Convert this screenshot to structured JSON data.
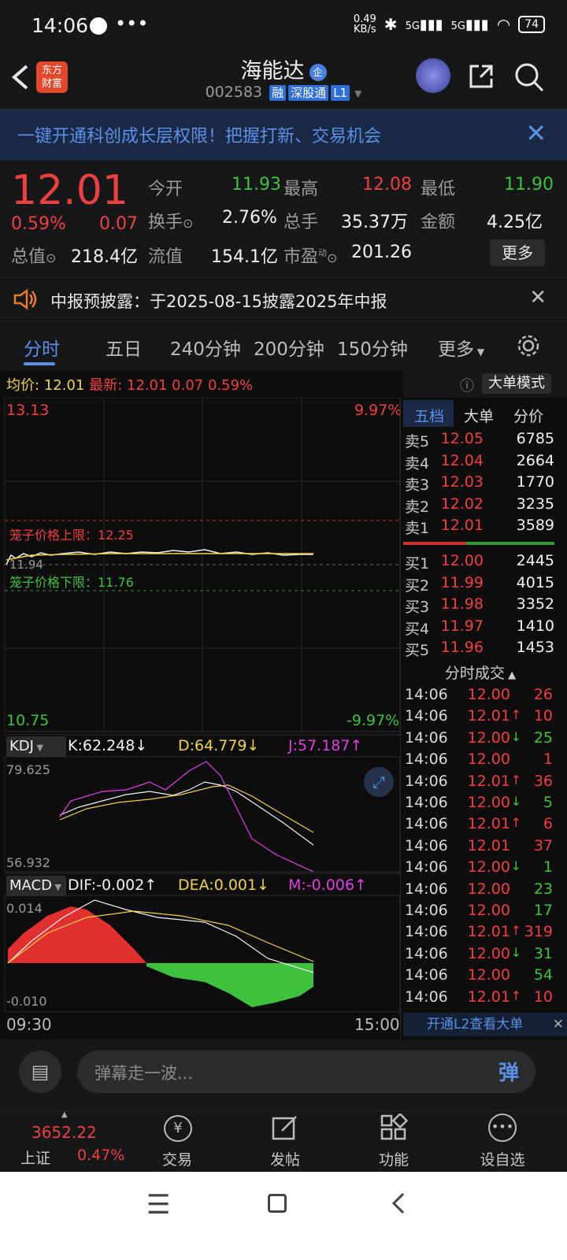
{
  "status": {
    "time": "14:06",
    "net_speed_top": "0.49",
    "net_speed_unit": "KB/s",
    "signal1": "5G",
    "signal2": "5G",
    "battery": "74"
  },
  "header": {
    "logo_line1": "东方",
    "logo_line2": "财富",
    "title": "海能达",
    "code": "002583",
    "badges": [
      "融",
      "深股通",
      "L1"
    ]
  },
  "banner": {
    "text": "一键开通科创成长层权限！把握打新、交易机会"
  },
  "quote": {
    "price": "12.01",
    "change_pct": "0.59%",
    "change": "0.07",
    "open_label": "今开",
    "open": "11.93",
    "high_label": "最高",
    "high": "12.08",
    "low_label": "最低",
    "low": "11.90",
    "turnover_label": "换手",
    "turnover": "2.76%",
    "volume_label": "总手",
    "volume": "35.37万",
    "amount_label": "金额",
    "amount": "4.25亿",
    "mcap_label": "总值",
    "mcap": "218.4亿",
    "float_label": "流值",
    "float": "154.1亿",
    "pe_label": "市盈",
    "pe_sup": "动",
    "pe": "201.26",
    "more": "更多"
  },
  "notice": {
    "text": "中报预披露：于2025-08-15披露2025年中报"
  },
  "tabs": [
    "分时",
    "五日",
    "240分钟",
    "200分钟",
    "150分钟",
    "更多"
  ],
  "chart": {
    "avg_label": "均价:",
    "avg": "12.01",
    "latest_label": "最新:",
    "latest": "12.01",
    "chg": "0.07",
    "chg_pct": "0.59%",
    "big_mode": "大单模式",
    "top_price": "13.13",
    "top_pct": "9.97%",
    "bottom_price": "10.75",
    "bottom_pct": "-9.97%",
    "mid_price": "11.94",
    "upper_limit": "笼子价格上限：12.25",
    "lower_limit": "笼子价格下限：11.76",
    "kdj_label": "KDJ",
    "k": "K:62.248",
    "d": "D:64.779",
    "j": "J:57.187",
    "kdj_top": "79.625",
    "kdj_bottom": "56.932",
    "macd_label": "MACD",
    "dif": "DIF:-0.002",
    "dea": "DEA:0.001",
    "m": "M:-0.006",
    "macd_top": "0.014",
    "macd_bottom": "-0.010",
    "time_start": "09:30",
    "time_end": "15:00"
  },
  "orderbook": {
    "tabs": [
      "五档",
      "大单",
      "分价"
    ],
    "asks": [
      {
        "label": "卖5",
        "price": "12.05",
        "vol": "6785"
      },
      {
        "label": "卖4",
        "price": "12.04",
        "vol": "2664"
      },
      {
        "label": "卖3",
        "price": "12.03",
        "vol": "1770"
      },
      {
        "label": "卖2",
        "price": "12.02",
        "vol": "3235"
      },
      {
        "label": "卖1",
        "price": "12.01",
        "vol": "3589"
      }
    ],
    "bids": [
      {
        "label": "买1",
        "price": "12.00",
        "vol": "2445"
      },
      {
        "label": "买2",
        "price": "11.99",
        "vol": "4015"
      },
      {
        "label": "买3",
        "price": "11.98",
        "vol": "3352"
      },
      {
        "label": "买4",
        "price": "11.97",
        "vol": "1410"
      },
      {
        "label": "买5",
        "price": "11.96",
        "vol": "1453"
      }
    ],
    "trades_title": "分时成交",
    "trades": [
      {
        "t": "14:06",
        "p": "12.00",
        "d": "",
        "v": "26",
        "c": "r"
      },
      {
        "t": "14:06",
        "p": "12.01",
        "d": "↑",
        "v": "10",
        "c": "r"
      },
      {
        "t": "14:06",
        "p": "12.00",
        "d": "↓",
        "v": "25",
        "c": "g"
      },
      {
        "t": "14:06",
        "p": "12.00",
        "d": "",
        "v": "1",
        "c": "r"
      },
      {
        "t": "14:06",
        "p": "12.01",
        "d": "↑",
        "v": "36",
        "c": "r"
      },
      {
        "t": "14:06",
        "p": "12.00",
        "d": "↓",
        "v": "5",
        "c": "g"
      },
      {
        "t": "14:06",
        "p": "12.01",
        "d": "↑",
        "v": "6",
        "c": "r"
      },
      {
        "t": "14:06",
        "p": "12.01",
        "d": "",
        "v": "37",
        "c": "r"
      },
      {
        "t": "14:06",
        "p": "12.00",
        "d": "↓",
        "v": "1",
        "c": "g"
      },
      {
        "t": "14:06",
        "p": "12.00",
        "d": "",
        "v": "23",
        "c": "g"
      },
      {
        "t": "14:06",
        "p": "12.00",
        "d": "",
        "v": "17",
        "c": "g"
      },
      {
        "t": "14:06",
        "p": "12.01",
        "d": "↑",
        "v": "319",
        "c": "r"
      },
      {
        "t": "14:06",
        "p": "12.00",
        "d": "↓",
        "v": "31",
        "c": "g"
      },
      {
        "t": "14:06",
        "p": "12.00",
        "d": "",
        "v": "54",
        "c": "g"
      },
      {
        "t": "14:06",
        "p": "12.01",
        "d": "↑",
        "v": "10",
        "c": "r"
      }
    ],
    "l2_link": "开通L2查看大单"
  },
  "input": {
    "placeholder": "弹幕走一波...",
    "send": "弹"
  },
  "nav": {
    "index_value": "3652.22",
    "index_name": "上证",
    "index_pct": "0.47%",
    "items": [
      "交易",
      "发帖",
      "功能",
      "设自选"
    ]
  },
  "colors": {
    "up": "#ef4040",
    "down": "#3ec23e",
    "accent": "#5b8fe8",
    "bg": "#161718"
  }
}
